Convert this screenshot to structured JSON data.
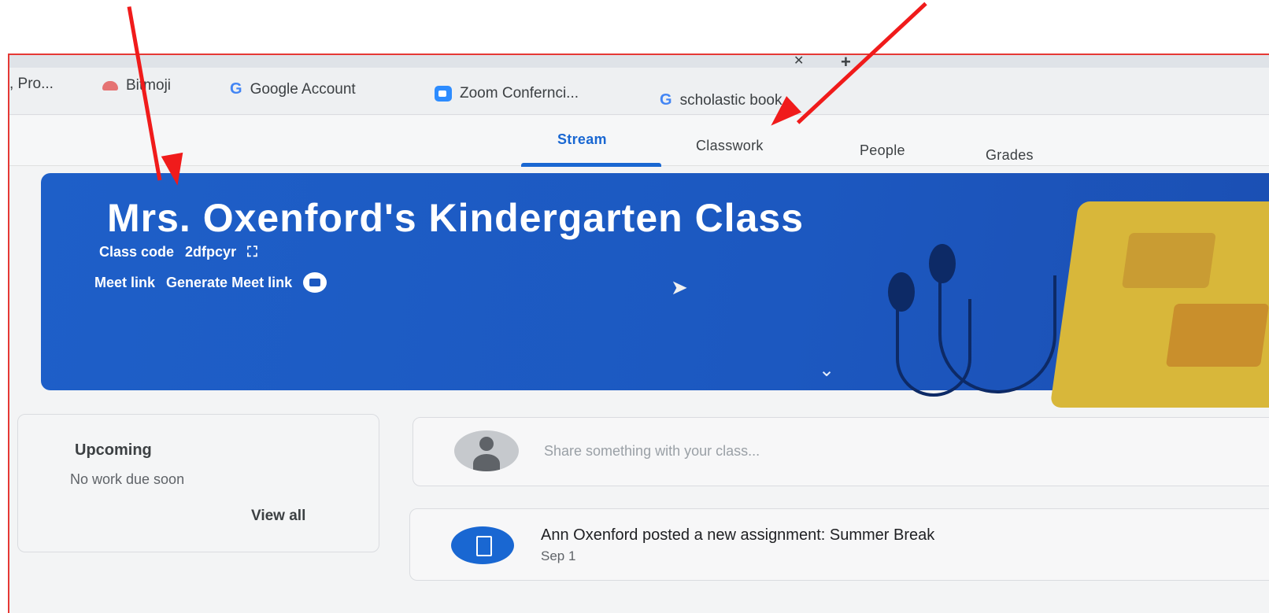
{
  "tab_strip": {
    "close_glyph": "✕",
    "new_tab_glyph": "+"
  },
  "bookmarks": [
    {
      "label": ", Pro...",
      "icon": "none"
    },
    {
      "label": "Bitmoji",
      "icon": "bitmoji-icon"
    },
    {
      "label": "Google Account",
      "icon": "google-icon"
    },
    {
      "label": "Zoom Confernci...",
      "icon": "zoom-icon"
    },
    {
      "label": "scholastic book...",
      "icon": "google-icon"
    }
  ],
  "nav": {
    "tabs": [
      {
        "label": "Stream",
        "active": true
      },
      {
        "label": "Classwork",
        "active": false
      },
      {
        "label": "People",
        "active": false
      },
      {
        "label": "Grades",
        "active": false
      }
    ]
  },
  "banner": {
    "title": "Mrs. Oxenford's Kindergarten Class",
    "class_code_label": "Class code",
    "class_code": "2dfpcyr",
    "meet_label": "Meet link",
    "meet_action": "Generate Meet link",
    "background": "#1c58c0"
  },
  "upcoming": {
    "title": "Upcoming",
    "empty_text": "No work due soon",
    "view_all": "View all"
  },
  "share": {
    "placeholder": "Share something with your class..."
  },
  "posts": [
    {
      "text": "Ann Oxenford posted a new assignment: Summer Break",
      "date": "Sep 1"
    }
  ],
  "annotation_color": "#f01b1b",
  "accent_color": "#1967d2"
}
